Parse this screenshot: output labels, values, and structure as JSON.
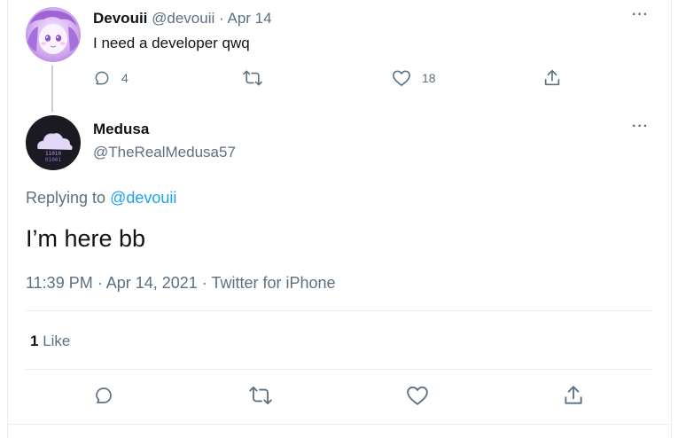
{
  "parent_tweet": {
    "name": "Devouii",
    "handle": "@devouii",
    "separator": "·",
    "date": "Apr 14",
    "text": "I need a developer qwq",
    "reply_count": "4",
    "like_count": "18",
    "more_icon": "more-horizontal-icon"
  },
  "main_tweet": {
    "name": "Medusa",
    "handle": "@TheRealMedusa57",
    "replying_prefix": "Replying to",
    "replying_mention": "@devouii",
    "text": "I’m here bb",
    "timestamp": "11:39 PM · Apr 14, 2021 · Twitter for iPhone",
    "like_stat_count": "1",
    "like_stat_label": "Like",
    "avatar_text_top": "11010",
    "avatar_text_bottom": "01001"
  },
  "icons": {
    "reply": "reply-icon",
    "retweet": "retweet-icon",
    "like": "heart-icon",
    "share": "share-icon"
  },
  "colors": {
    "accent": "#1da1f2",
    "secondary_text": "#5b7083",
    "primary_text": "#0f1419",
    "border": "#ebeef0"
  }
}
